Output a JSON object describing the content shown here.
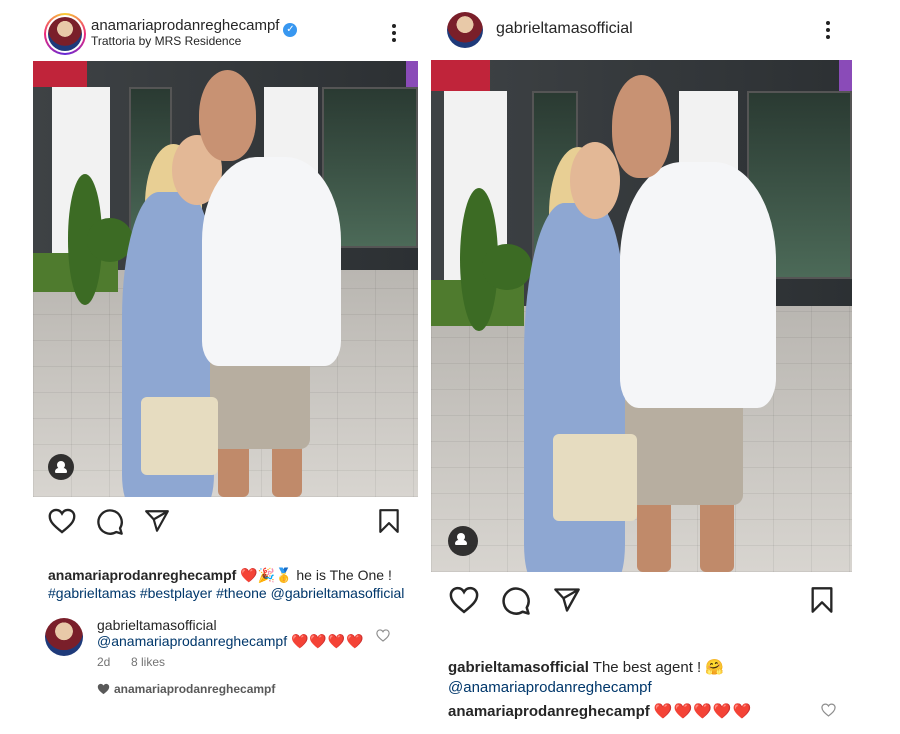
{
  "left_post": {
    "author": "anamariaprodanreghecampf",
    "verified_icon": "verified-badge-icon",
    "location": "Trattoria by MRS Residence",
    "caption": {
      "username": "anamariaprodanreghecampf",
      "emojis": "❤️🎉🥇",
      "text": " he is The One !",
      "hashtags": [
        "#gabrieltamas",
        "#bestplayer",
        "#theone",
        "@gabrieltamasofficial"
      ]
    },
    "comment": {
      "username": "gabrieltamasofficial",
      "mention": "@anamariaprodanreghecampf",
      "hearts": "❤️❤️❤️❤️",
      "age": "2d",
      "likes": "8 likes"
    },
    "liked_by": "anamariaprodanreghecampf"
  },
  "right_post": {
    "author": "gabrieltamasofficial",
    "caption": {
      "username": "gabrieltamasofficial",
      "text": " The best agent ! 🤗",
      "mention": "@anamariaprodanreghecampf"
    },
    "comment": {
      "username": "anamariaprodanreghecampf",
      "hearts": "❤️❤️❤️❤️❤️"
    }
  },
  "colors": {
    "text": "#262626",
    "link": "#00376b",
    "verified": "#3897f0",
    "heart": "#ed1c24"
  }
}
